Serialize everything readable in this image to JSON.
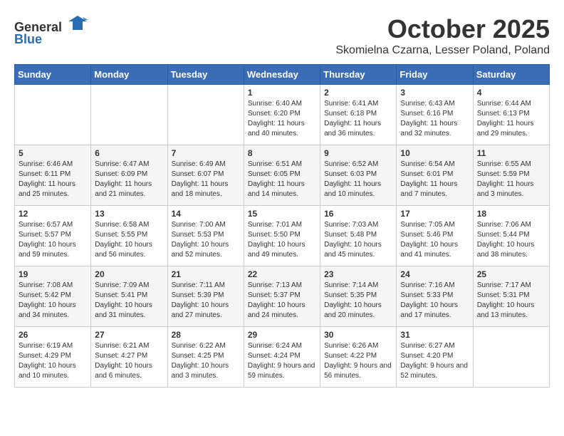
{
  "header": {
    "logo_general": "General",
    "logo_blue": "Blue",
    "month": "October 2025",
    "location": "Skomielna Czarna, Lesser Poland, Poland"
  },
  "weekdays": [
    "Sunday",
    "Monday",
    "Tuesday",
    "Wednesday",
    "Thursday",
    "Friday",
    "Saturday"
  ],
  "weeks": [
    [
      {
        "day": "",
        "sunrise": "",
        "sunset": "",
        "daylight": ""
      },
      {
        "day": "",
        "sunrise": "",
        "sunset": "",
        "daylight": ""
      },
      {
        "day": "",
        "sunrise": "",
        "sunset": "",
        "daylight": ""
      },
      {
        "day": "1",
        "sunrise": "Sunrise: 6:40 AM",
        "sunset": "Sunset: 6:20 PM",
        "daylight": "Daylight: 11 hours and 40 minutes."
      },
      {
        "day": "2",
        "sunrise": "Sunrise: 6:41 AM",
        "sunset": "Sunset: 6:18 PM",
        "daylight": "Daylight: 11 hours and 36 minutes."
      },
      {
        "day": "3",
        "sunrise": "Sunrise: 6:43 AM",
        "sunset": "Sunset: 6:16 PM",
        "daylight": "Daylight: 11 hours and 32 minutes."
      },
      {
        "day": "4",
        "sunrise": "Sunrise: 6:44 AM",
        "sunset": "Sunset: 6:13 PM",
        "daylight": "Daylight: 11 hours and 29 minutes."
      }
    ],
    [
      {
        "day": "5",
        "sunrise": "Sunrise: 6:46 AM",
        "sunset": "Sunset: 6:11 PM",
        "daylight": "Daylight: 11 hours and 25 minutes."
      },
      {
        "day": "6",
        "sunrise": "Sunrise: 6:47 AM",
        "sunset": "Sunset: 6:09 PM",
        "daylight": "Daylight: 11 hours and 21 minutes."
      },
      {
        "day": "7",
        "sunrise": "Sunrise: 6:49 AM",
        "sunset": "Sunset: 6:07 PM",
        "daylight": "Daylight: 11 hours and 18 minutes."
      },
      {
        "day": "8",
        "sunrise": "Sunrise: 6:51 AM",
        "sunset": "Sunset: 6:05 PM",
        "daylight": "Daylight: 11 hours and 14 minutes."
      },
      {
        "day": "9",
        "sunrise": "Sunrise: 6:52 AM",
        "sunset": "Sunset: 6:03 PM",
        "daylight": "Daylight: 11 hours and 10 minutes."
      },
      {
        "day": "10",
        "sunrise": "Sunrise: 6:54 AM",
        "sunset": "Sunset: 6:01 PM",
        "daylight": "Daylight: 11 hours and 7 minutes."
      },
      {
        "day": "11",
        "sunrise": "Sunrise: 6:55 AM",
        "sunset": "Sunset: 5:59 PM",
        "daylight": "Daylight: 11 hours and 3 minutes."
      }
    ],
    [
      {
        "day": "12",
        "sunrise": "Sunrise: 6:57 AM",
        "sunset": "Sunset: 5:57 PM",
        "daylight": "Daylight: 10 hours and 59 minutes."
      },
      {
        "day": "13",
        "sunrise": "Sunrise: 6:58 AM",
        "sunset": "Sunset: 5:55 PM",
        "daylight": "Daylight: 10 hours and 56 minutes."
      },
      {
        "day": "14",
        "sunrise": "Sunrise: 7:00 AM",
        "sunset": "Sunset: 5:53 PM",
        "daylight": "Daylight: 10 hours and 52 minutes."
      },
      {
        "day": "15",
        "sunrise": "Sunrise: 7:01 AM",
        "sunset": "Sunset: 5:50 PM",
        "daylight": "Daylight: 10 hours and 49 minutes."
      },
      {
        "day": "16",
        "sunrise": "Sunrise: 7:03 AM",
        "sunset": "Sunset: 5:48 PM",
        "daylight": "Daylight: 10 hours and 45 minutes."
      },
      {
        "day": "17",
        "sunrise": "Sunrise: 7:05 AM",
        "sunset": "Sunset: 5:46 PM",
        "daylight": "Daylight: 10 hours and 41 minutes."
      },
      {
        "day": "18",
        "sunrise": "Sunrise: 7:06 AM",
        "sunset": "Sunset: 5:44 PM",
        "daylight": "Daylight: 10 hours and 38 minutes."
      }
    ],
    [
      {
        "day": "19",
        "sunrise": "Sunrise: 7:08 AM",
        "sunset": "Sunset: 5:42 PM",
        "daylight": "Daylight: 10 hours and 34 minutes."
      },
      {
        "day": "20",
        "sunrise": "Sunrise: 7:09 AM",
        "sunset": "Sunset: 5:41 PM",
        "daylight": "Daylight: 10 hours and 31 minutes."
      },
      {
        "day": "21",
        "sunrise": "Sunrise: 7:11 AM",
        "sunset": "Sunset: 5:39 PM",
        "daylight": "Daylight: 10 hours and 27 minutes."
      },
      {
        "day": "22",
        "sunrise": "Sunrise: 7:13 AM",
        "sunset": "Sunset: 5:37 PM",
        "daylight": "Daylight: 10 hours and 24 minutes."
      },
      {
        "day": "23",
        "sunrise": "Sunrise: 7:14 AM",
        "sunset": "Sunset: 5:35 PM",
        "daylight": "Daylight: 10 hours and 20 minutes."
      },
      {
        "day": "24",
        "sunrise": "Sunrise: 7:16 AM",
        "sunset": "Sunset: 5:33 PM",
        "daylight": "Daylight: 10 hours and 17 minutes."
      },
      {
        "day": "25",
        "sunrise": "Sunrise: 7:17 AM",
        "sunset": "Sunset: 5:31 PM",
        "daylight": "Daylight: 10 hours and 13 minutes."
      }
    ],
    [
      {
        "day": "26",
        "sunrise": "Sunrise: 6:19 AM",
        "sunset": "Sunset: 4:29 PM",
        "daylight": "Daylight: 10 hours and 10 minutes."
      },
      {
        "day": "27",
        "sunrise": "Sunrise: 6:21 AM",
        "sunset": "Sunset: 4:27 PM",
        "daylight": "Daylight: 10 hours and 6 minutes."
      },
      {
        "day": "28",
        "sunrise": "Sunrise: 6:22 AM",
        "sunset": "Sunset: 4:25 PM",
        "daylight": "Daylight: 10 hours and 3 minutes."
      },
      {
        "day": "29",
        "sunrise": "Sunrise: 6:24 AM",
        "sunset": "Sunset: 4:24 PM",
        "daylight": "Daylight: 9 hours and 59 minutes."
      },
      {
        "day": "30",
        "sunrise": "Sunrise: 6:26 AM",
        "sunset": "Sunset: 4:22 PM",
        "daylight": "Daylight: 9 hours and 56 minutes."
      },
      {
        "day": "31",
        "sunrise": "Sunrise: 6:27 AM",
        "sunset": "Sunset: 4:20 PM",
        "daylight": "Daylight: 9 hours and 52 minutes."
      },
      {
        "day": "",
        "sunrise": "",
        "sunset": "",
        "daylight": ""
      }
    ]
  ]
}
